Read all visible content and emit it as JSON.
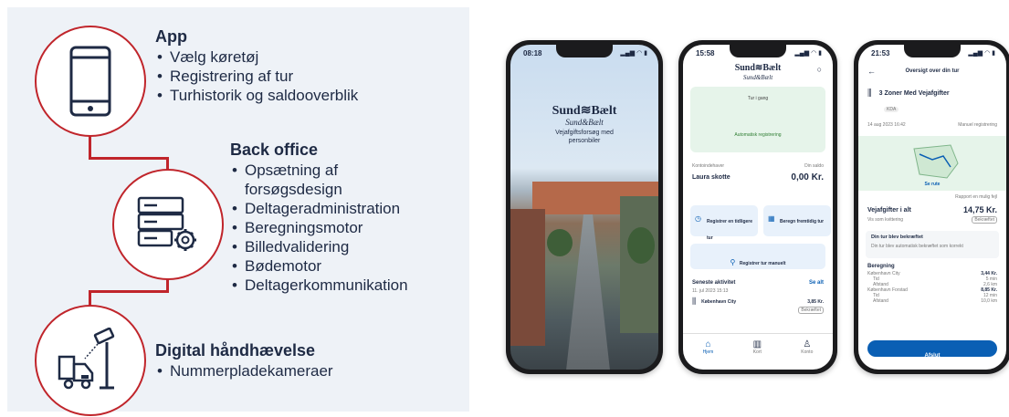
{
  "sections": {
    "app": {
      "title": "App",
      "items": [
        "Vælg køretøj",
        "Registrering af tur",
        "Turhistorik og saldooverblik"
      ]
    },
    "backoffice": {
      "title": "Back office",
      "items": [
        "Opsætning af forsøgsdesign",
        "Deltageradministration",
        "Beregningsmotor",
        "Billedvalidering",
        "Bødemotor",
        "Deltagerkommunikation"
      ]
    },
    "enforcement": {
      "title": "Digital håndhævelse",
      "items": [
        "Nummerpladekameraer"
      ]
    }
  },
  "phone1": {
    "time": "08:18",
    "brand": "Sund≋Bælt",
    "brand_sub": "Sund&Bælt",
    "tagline": "Vejafgiftsforsøg med personbiler"
  },
  "phone2": {
    "time": "15:58",
    "brand": "Sund≋Bælt",
    "brand_sub": "Sund&Bælt",
    "trip_status": "Tur i gang",
    "auto_reg": "Automatisk registrering",
    "account_label": "Kontoindehaver",
    "account_name": "Laura skotte",
    "balance_label": "Din saldo",
    "balance": "0,00 Kr.",
    "btn_register_earlier": "Registrer en tidligere tur",
    "btn_calc_future": "Beregn fremtidig tur",
    "btn_register_manual": "Registrer tur manuelt",
    "recent_title": "Seneste aktivitet",
    "see_all": "Se alt",
    "recent_date": "11. jul 2023 15:13",
    "recent_place": "København City",
    "recent_amount": "3,85 Kr.",
    "recent_status": "Bekræftet",
    "nav": [
      "Hjem",
      "Kort",
      "Konto"
    ]
  },
  "phone3": {
    "time": "21:53",
    "header": "Oversigt over din tur",
    "zones": "3 Zoner Med Vejafgifter",
    "vehicle": "KDA",
    "date": "14 aug 2023 16:42",
    "reg_type": "Manuel registrering",
    "map_label": "Se rute",
    "map_note": "Rapport en mulig fejl",
    "total_label": "Vejafgifter i alt",
    "total_value": "14,75 Kr.",
    "total_sub": "Vis som kvittering",
    "total_status": "Bekræftet",
    "confirm_title": "Din tur blev bekræftet",
    "confirm_text": "Din tur blev automatisk bekræftet som korrekt",
    "calc_title": "Beregning",
    "calc_rows": [
      {
        "label": "København City",
        "value": "3,44 Kr."
      },
      {
        "label": "Tid",
        "value": "5 min"
      },
      {
        "label": "Afstand",
        "value": "2,6 km"
      },
      {
        "label": "København Forstad",
        "value": "8,85 Kr."
      },
      {
        "label": "Tid",
        "value": "12 min"
      },
      {
        "label": "Afstand",
        "value": "10,0 km"
      }
    ],
    "action": "Afslut"
  },
  "colors": {
    "accent": "#c0252b",
    "navy": "#1e2a44",
    "app_blue": "#0a5fb4",
    "light_green": "#e6f4ea",
    "light_blue": "#e8f1fb"
  }
}
